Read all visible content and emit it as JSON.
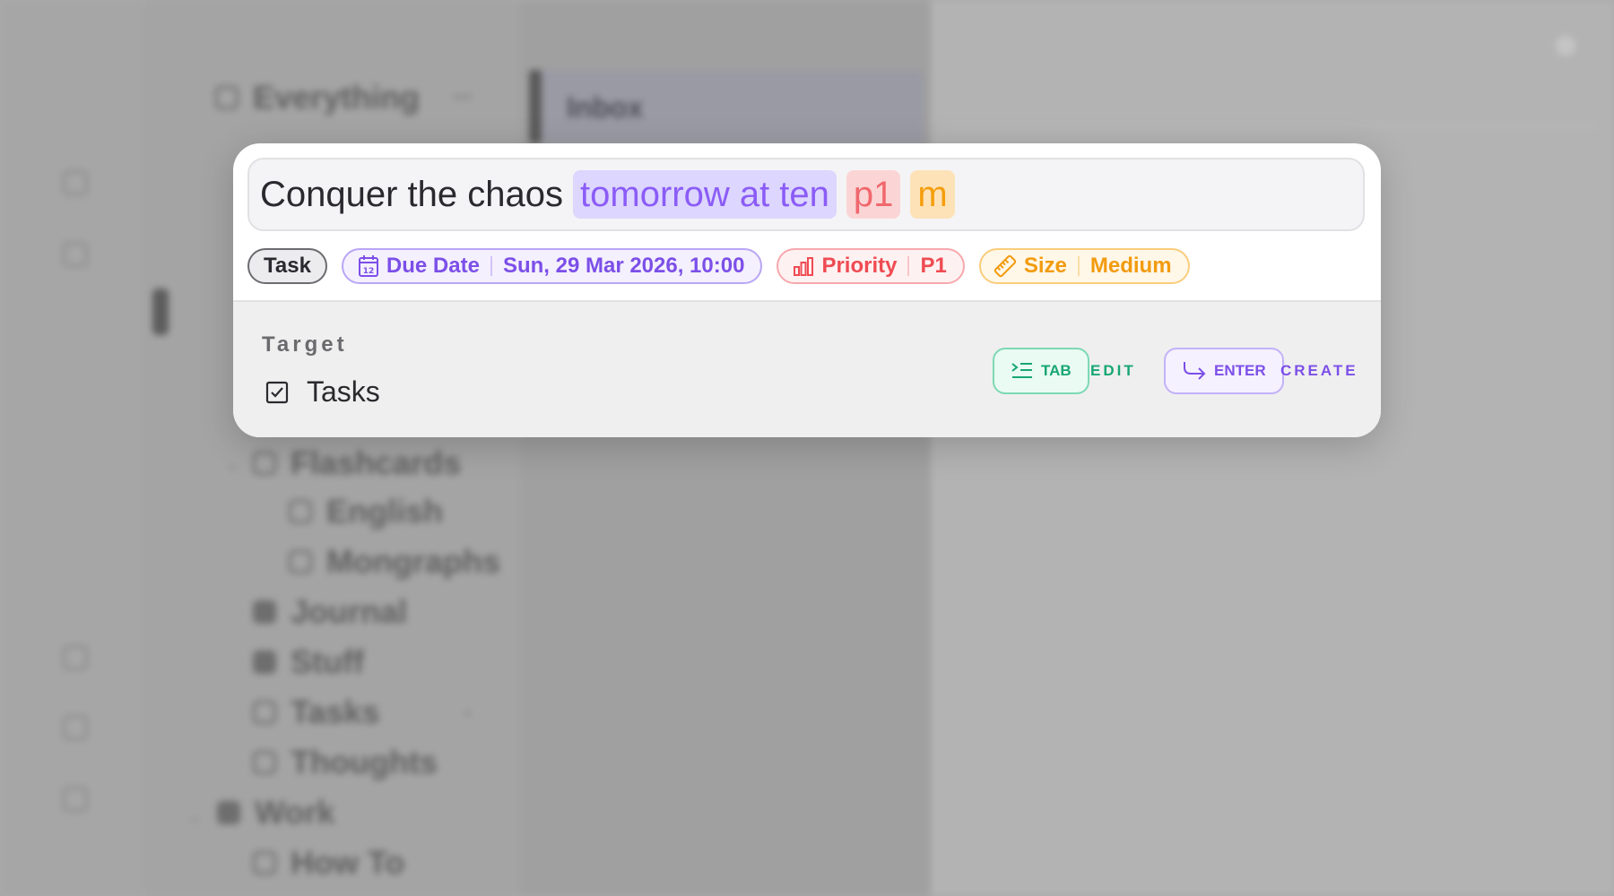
{
  "background_app": {
    "list_title": "Inbox",
    "sidebar_items": [
      "Everything",
      "Flashcards",
      "English",
      "Mongraphs",
      "Journal",
      "Stuff",
      "Tasks",
      "Thoughts",
      "Work",
      "How To"
    ]
  },
  "quick_add": {
    "input": {
      "plain_text": "Conquer the chaos",
      "date_token": "tomorrow at ten",
      "priority_token": "p1",
      "size_token": "m"
    },
    "chips": {
      "type": "Task",
      "due_date": {
        "label": "Due Date",
        "value": "Sun, 29 Mar 2026, 10:00",
        "icon": "calendar-icon"
      },
      "priority": {
        "label": "Priority",
        "value": "P1",
        "icon": "bar-chart-icon"
      },
      "size": {
        "label": "Size",
        "value": "Medium",
        "icon": "ruler-icon"
      }
    },
    "target": {
      "heading": "Target",
      "name": "Tasks",
      "icon": "checkbox-icon"
    },
    "shortcuts": {
      "tab": {
        "key": "TAB",
        "action": "EDIT",
        "icon": "indent-icon"
      },
      "enter": {
        "key": "ENTER",
        "action": "CREATE",
        "icon": "return-arrow-icon"
      }
    },
    "colors": {
      "date": "#8b5cf6",
      "priority": "#ef4b52",
      "size": "#f29b0e",
      "edit": "#17a673",
      "create": "#7c4fe8"
    }
  }
}
